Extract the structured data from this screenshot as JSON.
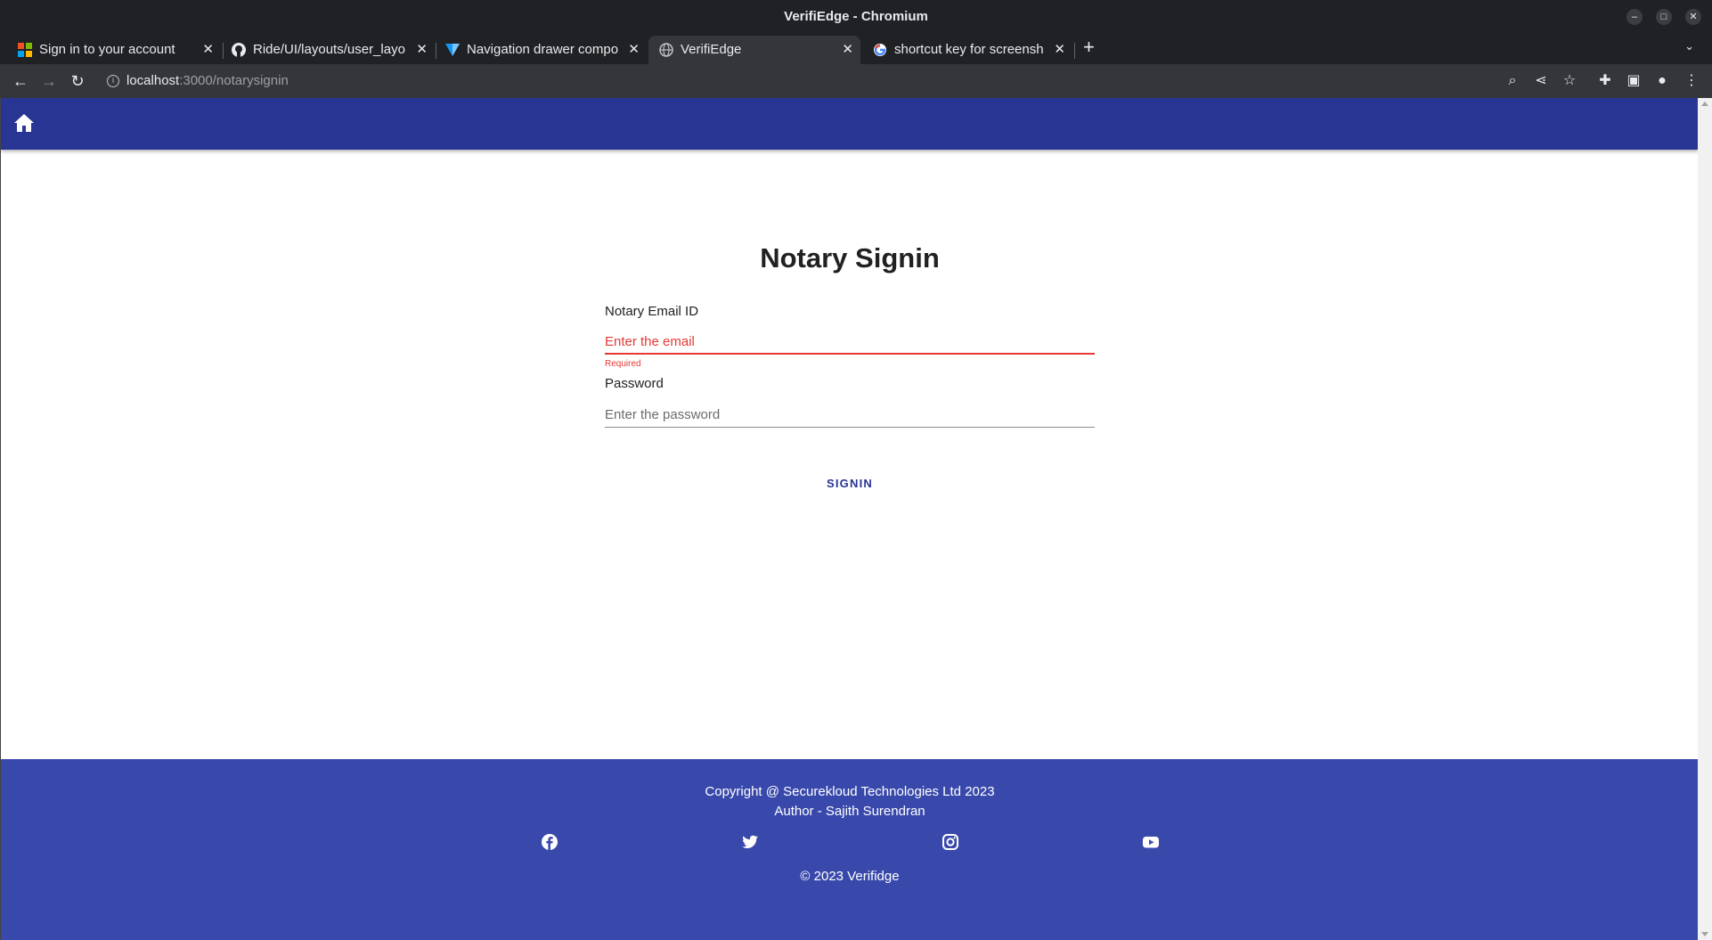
{
  "window": {
    "title": "VerifiEdge - Chromium"
  },
  "tabs": [
    {
      "title": "Sign in to your account",
      "icon": "microsoft-icon"
    },
    {
      "title": "Ride/UI/layouts/user_layo",
      "icon": "github-icon"
    },
    {
      "title": "Navigation drawer compo",
      "icon": "vuetify-icon"
    },
    {
      "title": "VerifiEdge",
      "icon": "globe-icon"
    },
    {
      "title": "shortcut key for screensho",
      "icon": "google-icon"
    }
  ],
  "address": {
    "host": "localhost",
    "path": ":3000/notarysignin"
  },
  "page": {
    "heading": "Notary Signin",
    "email": {
      "label": "Notary Email ID",
      "placeholder": "Enter the email",
      "value": "",
      "helper": "Required"
    },
    "password": {
      "label": "Password",
      "placeholder": "Enter the password",
      "value": ""
    },
    "signin_label": "SIGNIN"
  },
  "footer": {
    "copyright": "Copyright @ Securekloud Technologies Ltd 2023",
    "author": "Author - Sajith Surendran",
    "bottom": "© 2023 Verifidge",
    "social": [
      "facebook-icon",
      "twitter-icon",
      "instagram-icon",
      "youtube-icon"
    ]
  },
  "colors": {
    "appbar": "#283593",
    "footer": "#3949ab",
    "error": "#e53935",
    "button": "#283593"
  }
}
